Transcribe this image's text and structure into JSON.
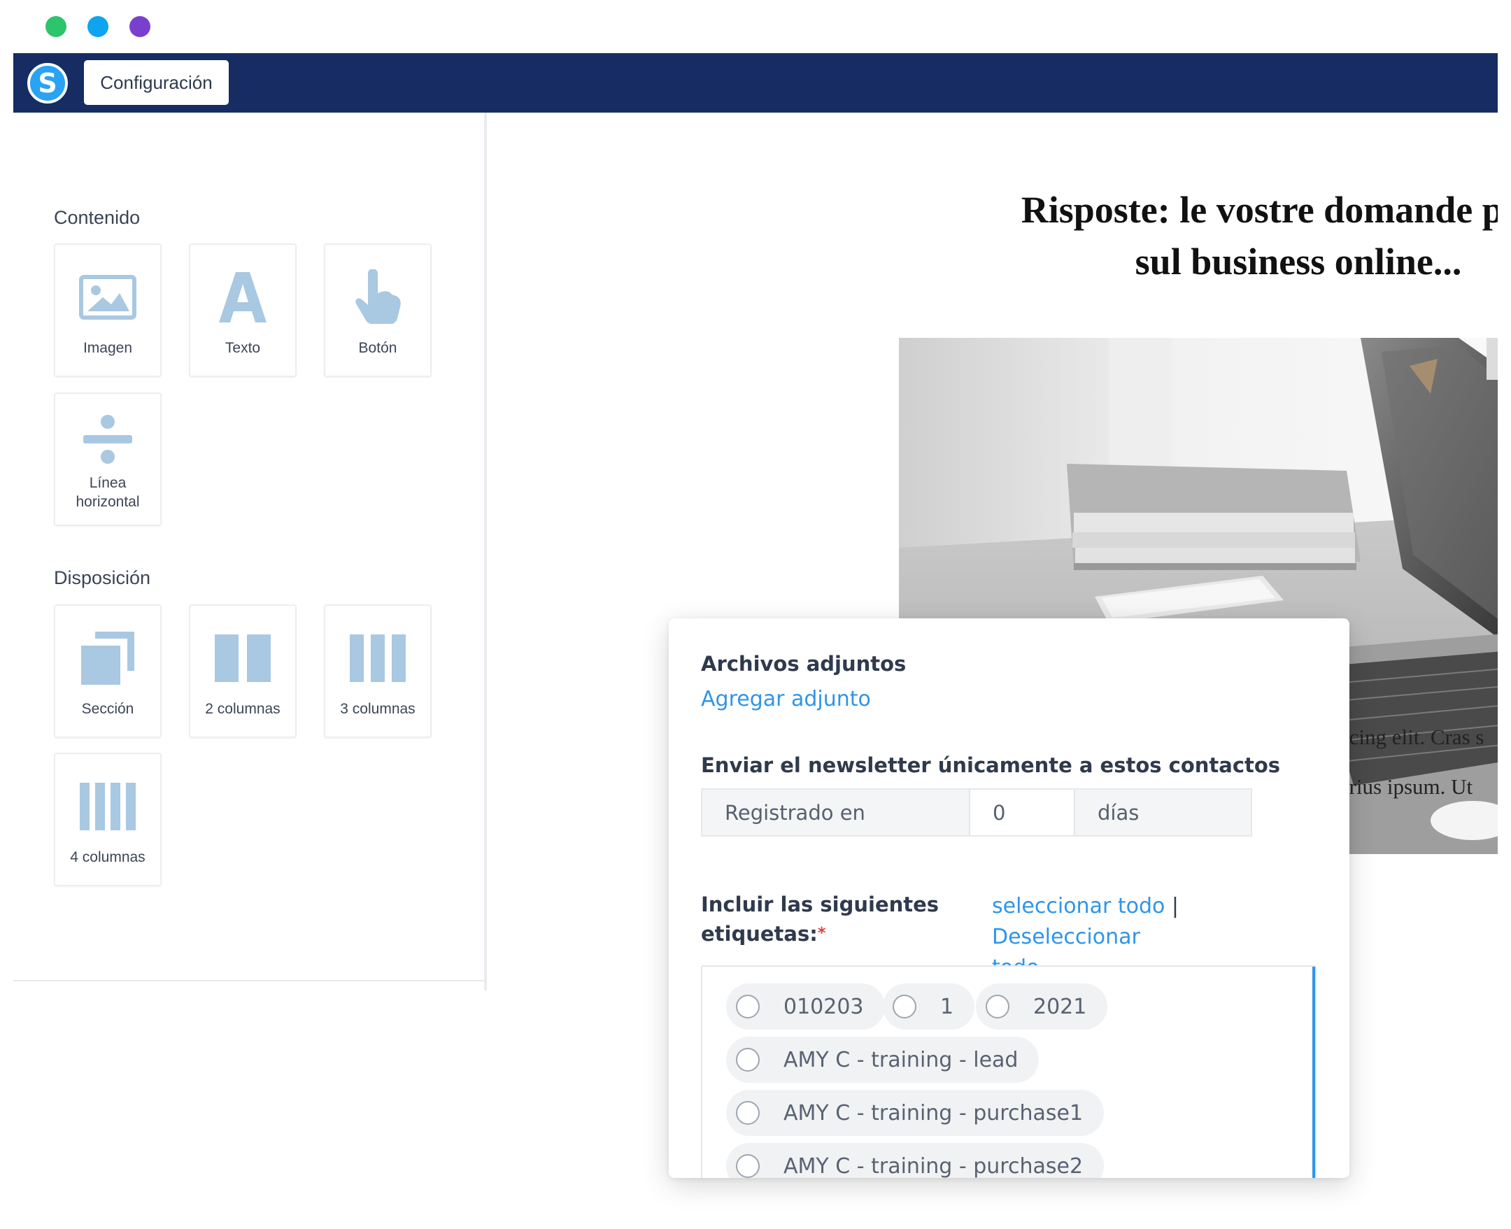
{
  "window": {
    "dot_colors": [
      "#2ec46b",
      "#0ea4f0",
      "#7a3fcf"
    ]
  },
  "topbar": {
    "logo_letter": "S",
    "config_label": "Configuración",
    "background": "#162c62"
  },
  "sidebar": {
    "content_title": "Contenido",
    "content_items": [
      {
        "label": "Imagen",
        "icon": "image-icon"
      },
      {
        "label": "Texto",
        "icon": "text-icon"
      },
      {
        "label": "Botón",
        "icon": "button-hand-icon"
      },
      {
        "label": "Línea horizontal",
        "label_line1": "Línea",
        "label_line2": "horizontal",
        "icon": "divider-icon"
      }
    ],
    "layout_title": "Disposición",
    "layout_items": [
      {
        "label": "Sección",
        "icon": "section-icon"
      },
      {
        "label": "2 columnas",
        "icon": "two-columns-icon"
      },
      {
        "label": "3 columnas",
        "icon": "three-columns-icon"
      },
      {
        "label": "4 columnas",
        "icon": "four-columns-icon"
      }
    ],
    "device_icons": [
      "desktop-icon",
      "mobile-icon"
    ],
    "icon_color": "#a9c8e2",
    "active_device_color": "#2f95e8"
  },
  "preview": {
    "title_line1": "Risposte: le vostre domande più sc",
    "title_line2": "sul business online...",
    "body_line1": "ıcing elit. Cras s",
    "body_line2": "ırius ipsum. Ut"
  },
  "modal": {
    "attachments_title": "Archivos adjuntos",
    "add_attachment_link": "Agregar adjunto",
    "send_only_title": "Enviar el newsletter únicamente a estos contactos",
    "registered_label": "Registrado en",
    "days_value": "0",
    "days_unit": "días",
    "include_tags_line1": "Incluir las siguientes",
    "include_tags_line2": "etiquetas:",
    "required_mark": "*",
    "select_all": "seleccionar todo",
    "separator": "|",
    "deselect_line1": "Deseleccionar",
    "deselect_line2": "todo",
    "tags": [
      "010203",
      "1",
      "2021",
      "AMY C - training - lead",
      "AMY C - training - purchase1",
      "AMY C - training - purchase2"
    ],
    "link_color": "#2f95e8",
    "required_color": "#e53e3e"
  }
}
